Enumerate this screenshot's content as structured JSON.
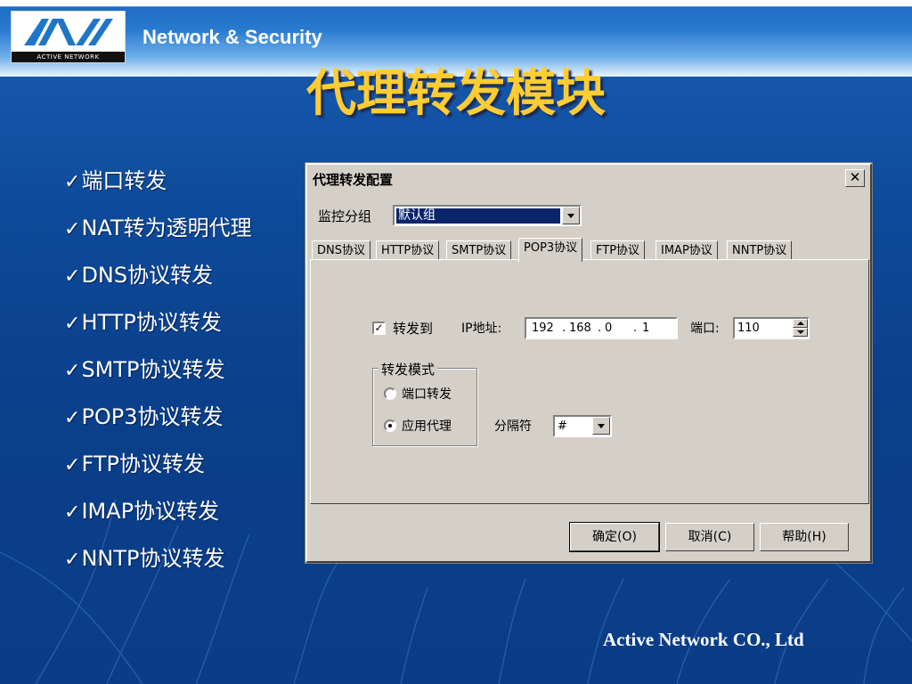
{
  "header": {
    "logo_caption": "ACTIVE NETWORK",
    "brand": "Network & Security",
    "title": "代理转发模块"
  },
  "bullets": [
    "端口转发",
    "NAT转为透明代理",
    "DNS协议转发",
    "HTTP协议转发",
    "SMTP协议转发",
    "POP3协议转发",
    "FTP协议转发",
    "IMAP协议转发",
    "NNTP协议转发"
  ],
  "dialog": {
    "title": "代理转发配置",
    "close_glyph": "✕",
    "group_label": "监控分组",
    "group_value": "默认组",
    "tabs": [
      "DNS协议",
      "HTTP协议",
      "SMTP协议",
      "POP3协议",
      "FTP协议",
      "IMAP协议",
      "NNTP协议"
    ],
    "active_tab": "POP3协议",
    "forward_checked": true,
    "forward_label": "转发到",
    "ip_label": "IP地址:",
    "ip": [
      "192",
      "168",
      "0",
      "1"
    ],
    "port_label": "端口:",
    "port_value": "110",
    "mode_group": "转发模式",
    "mode_options": [
      "端口转发",
      "应用代理"
    ],
    "mode_selected": "应用代理",
    "separator_label": "分隔符",
    "separator_value": "#",
    "buttons": {
      "ok": "确定(O)",
      "cancel": "取消(C)",
      "help": "帮助(H)"
    }
  },
  "footer": {
    "company": "Active Network CO., Ltd"
  },
  "colors": {
    "title": "#ffcc33",
    "background": "#0e4a9a",
    "dialog": "#d4d0c8",
    "selection": "#0a246a"
  }
}
